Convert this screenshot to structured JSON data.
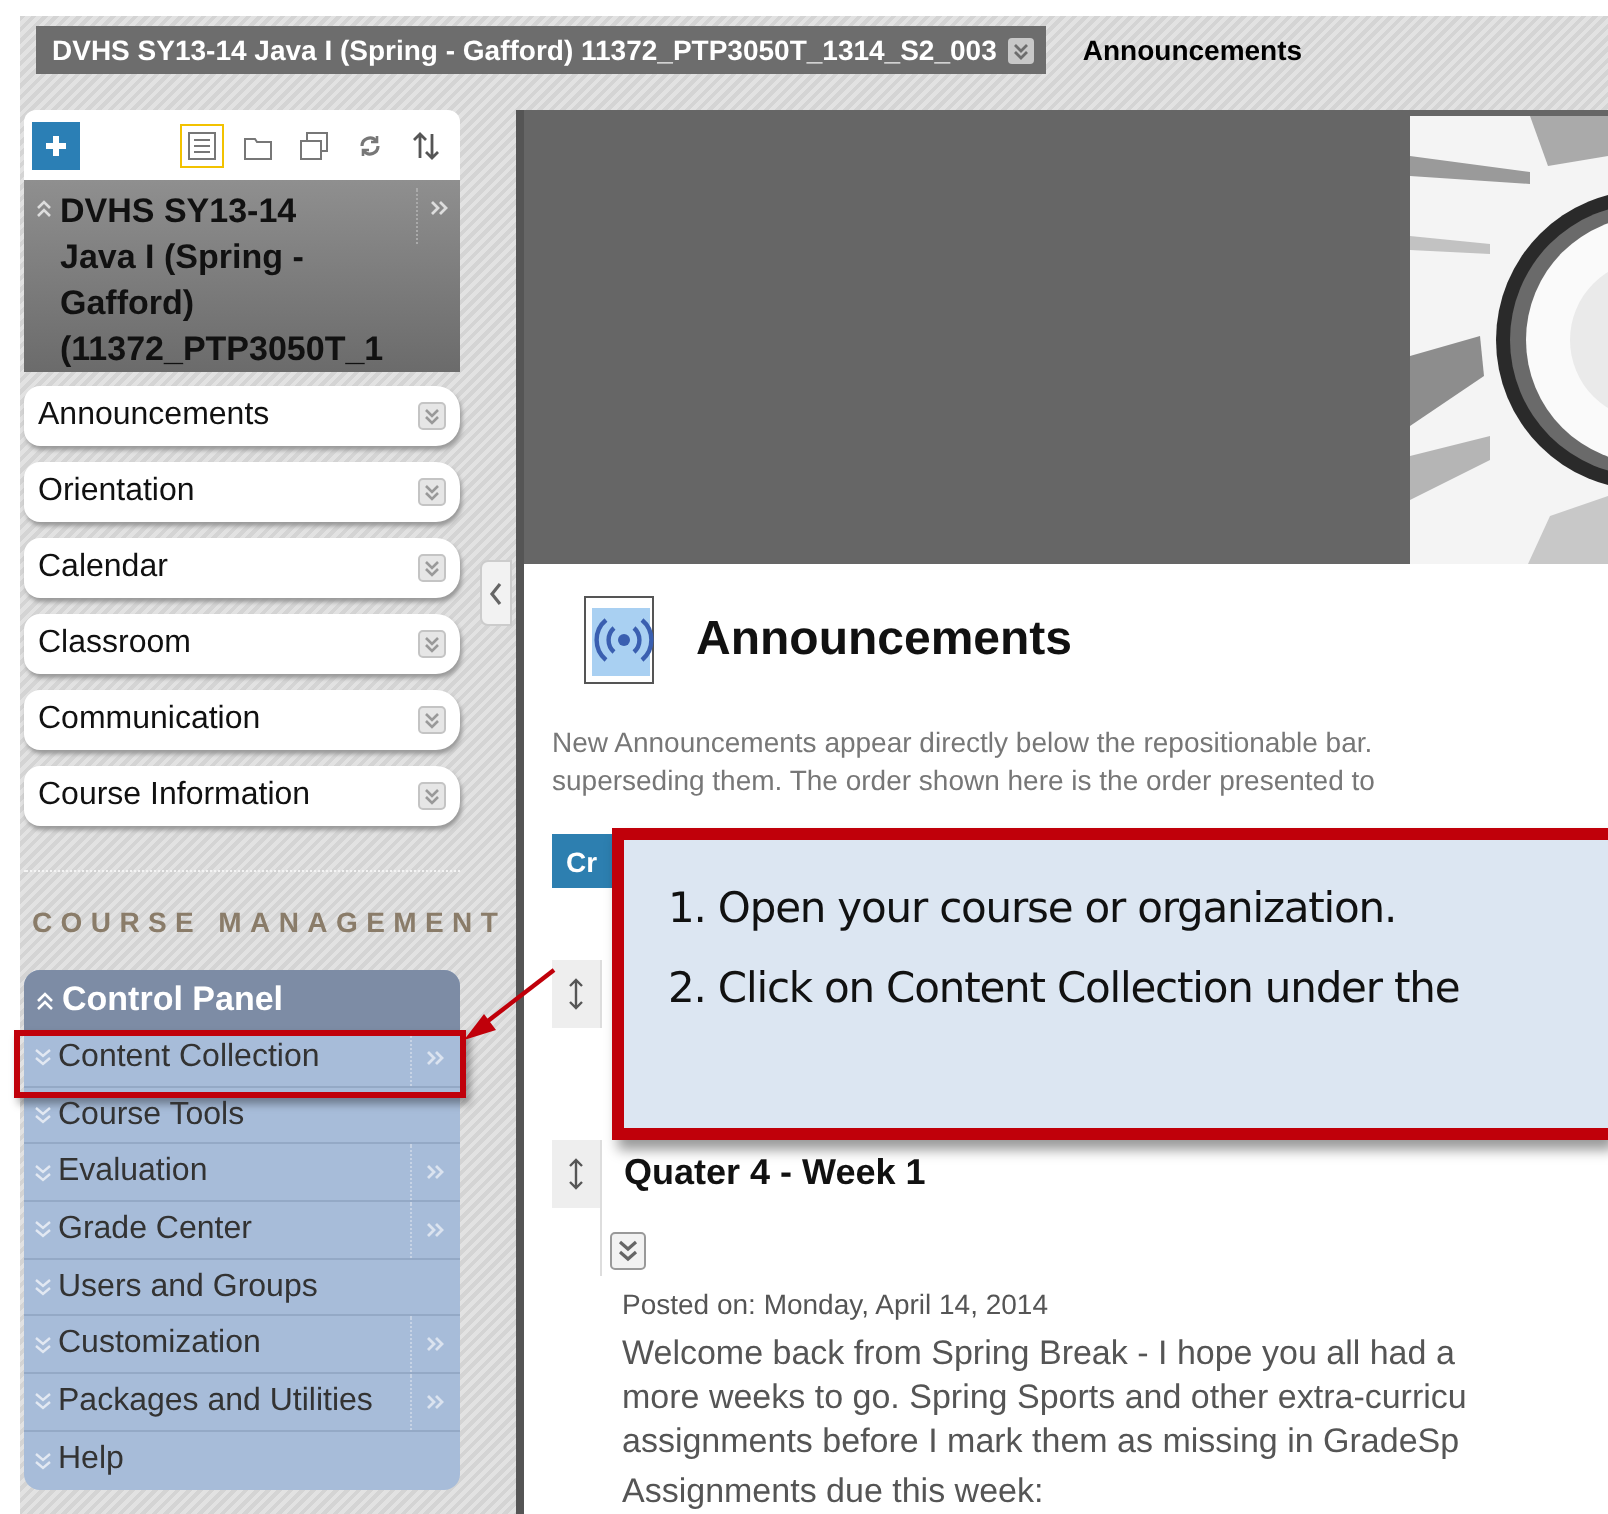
{
  "breadcrumb": {
    "course": "DVHS SY13-14 Java I (Spring - Gafford) 11372_PTP3050T_1314_S2_003",
    "page": "Announcements"
  },
  "sidebar": {
    "toolbar": [
      {
        "kind": "list",
        "selected": true
      },
      {
        "kind": "folder",
        "selected": false
      },
      {
        "kind": "windows",
        "selected": false
      },
      {
        "kind": "refresh",
        "selected": false
      },
      {
        "kind": "sort",
        "selected": false
      }
    ],
    "course_title_lines": [
      "DVHS SY13-14",
      "Java I (Spring -",
      "Gafford)",
      "(11372_PTP3050T_1"
    ],
    "menu": [
      {
        "label": "Announcements"
      },
      {
        "label": "Orientation"
      },
      {
        "label": "Calendar"
      },
      {
        "label": "Classroom"
      },
      {
        "label": "Communication"
      },
      {
        "label": "Course Information"
      }
    ]
  },
  "course_management": {
    "heading": "COURSE MANAGEMENT",
    "panel_title": "Control Panel",
    "items": [
      {
        "label": "Content Collection",
        "submenu": true,
        "highlighted": true
      },
      {
        "label": "Course Tools",
        "submenu": false,
        "highlighted": false
      },
      {
        "label": "Evaluation",
        "submenu": true,
        "highlighted": false
      },
      {
        "label": "Grade Center",
        "submenu": true,
        "highlighted": false
      },
      {
        "label": "Users and Groups",
        "submenu": false,
        "highlighted": false
      },
      {
        "label": "Customization",
        "submenu": true,
        "highlighted": false
      },
      {
        "label": "Packages and Utilities",
        "submenu": true,
        "highlighted": false
      },
      {
        "label": "Help",
        "submenu": false,
        "highlighted": false
      }
    ]
  },
  "content": {
    "title": "Announcements",
    "description_lines": [
      "New Announcements appear directly below the repositionable bar.",
      "superseding them. The order shown here is the order presented to"
    ],
    "create_button": "Cr",
    "announcements": [
      {
        "title": "Quater 4 - Week 1",
        "posted": "Posted on: Monday, April 14, 2014",
        "body_lines": [
          "Welcome back from Spring Break - I hope you all had a",
          "more weeks to go.  Spring Sports and other extra-curricu",
          "assignments before I mark them as missing in GradeSp"
        ],
        "footer": "Assignments due this week:"
      }
    ]
  },
  "callout": {
    "lines": [
      "1. Open your course or organization.",
      "2. Click on Content Collection under the"
    ]
  }
}
